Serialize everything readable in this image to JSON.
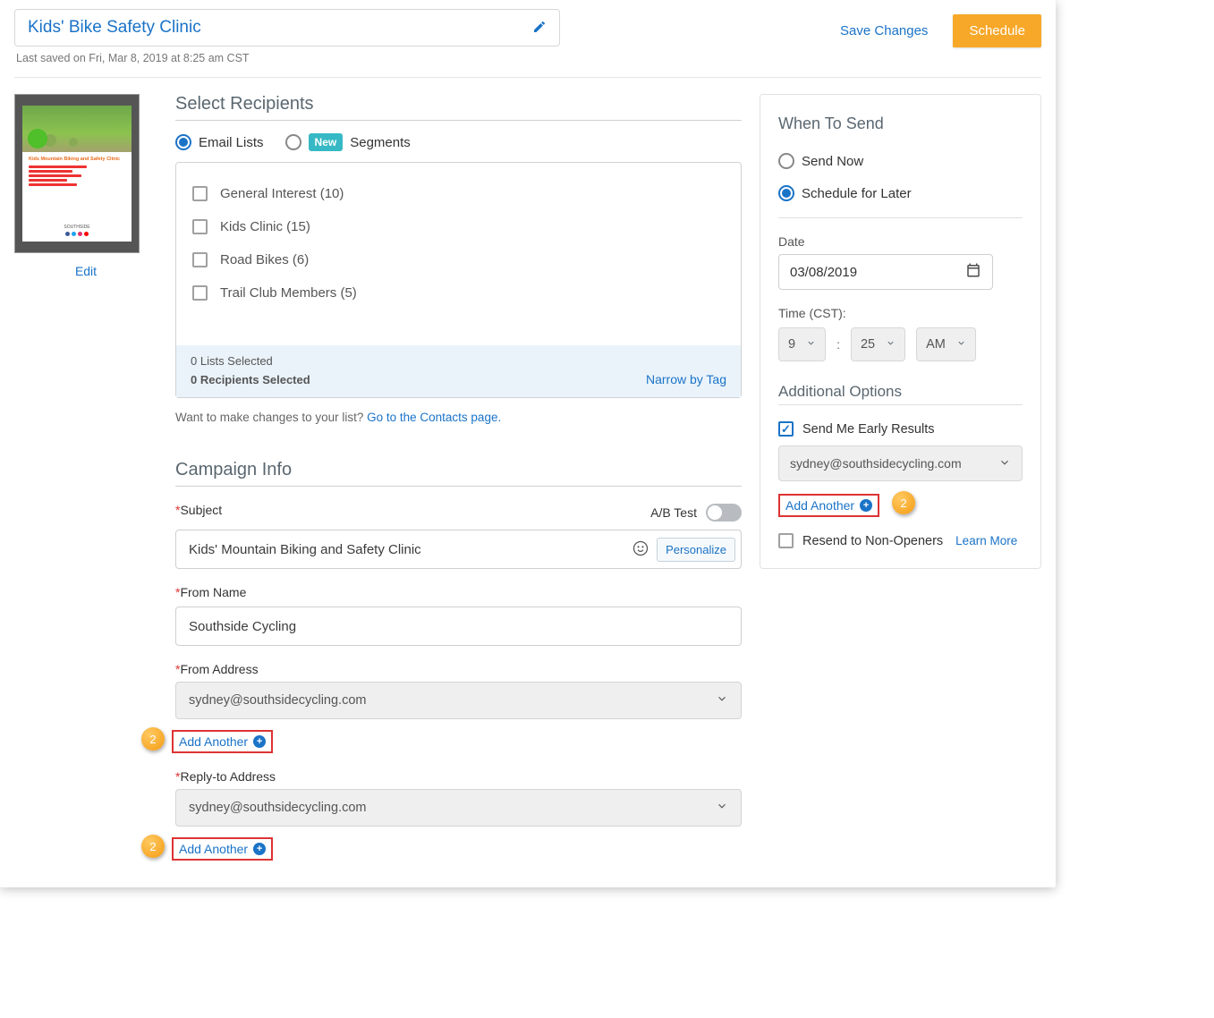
{
  "header": {
    "title": "Kids' Bike Safety Clinic",
    "lastSaved": "Last saved on Fri, Mar 8, 2019 at 8:25 am CST",
    "saveChanges": "Save Changes",
    "schedule": "Schedule"
  },
  "left": {
    "edit": "Edit",
    "thumbTitle": "Kids Mountain Biking and Safety Clinic"
  },
  "recipients": {
    "title": "Select Recipients",
    "emailLists": "Email Lists",
    "segments": "Segments",
    "newBadge": "New",
    "lists": [
      {
        "label": "General Interest (10)"
      },
      {
        "label": "Kids Clinic (15)"
      },
      {
        "label": "Road Bikes (6)"
      },
      {
        "label": "Trail Club Members (5)"
      }
    ],
    "listsSelected": "0 Lists Selected",
    "recipientsSelected": "0 Recipients Selected",
    "narrow": "Narrow by Tag",
    "helpText": "Want to make changes to your list? ",
    "helpLink": "Go to the Contacts page."
  },
  "campaign": {
    "title": "Campaign Info",
    "subjectLabel": "Subject",
    "abTest": "A/B Test",
    "subjectValue": "Kids' Mountain Biking and Safety Clinic",
    "personalize": "Personalize",
    "fromNameLabel": "From Name",
    "fromNameValue": "Southside Cycling",
    "fromAddressLabel": "From Address",
    "fromAddressValue": "sydney@southsidecycling.com",
    "replyLabel": "Reply-to Address",
    "replyValue": "sydney@southsidecycling.com",
    "addAnother": "Add Another",
    "badge": "2"
  },
  "send": {
    "title": "When To Send",
    "sendNow": "Send Now",
    "scheduleLater": "Schedule for Later",
    "dateLabel": "Date",
    "dateValue": "03/08/2019",
    "timeLabel": "Time (CST):",
    "hour": "9",
    "minute": "25",
    "ampm": "AM",
    "additional": "Additional Options",
    "earlyResults": "Send Me Early Results",
    "earlyEmail": "sydney@southsidecycling.com",
    "addAnother": "Add Another",
    "badge": "2",
    "resend": "Resend to Non-Openers",
    "learnMore": "Learn More"
  }
}
